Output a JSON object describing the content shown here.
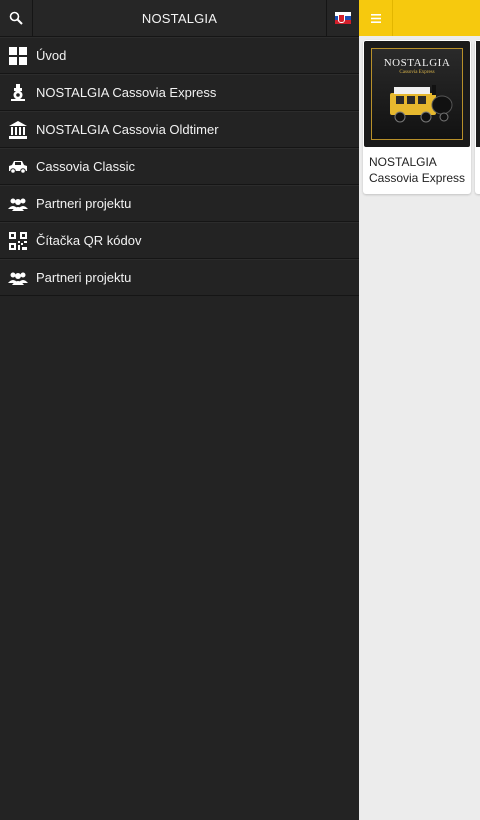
{
  "drawer": {
    "title": "NOSTALGIA",
    "items": [
      {
        "label": "Úvod",
        "icon": "grid-icon"
      },
      {
        "label": "NOSTALGIA Cassovia Express",
        "icon": "train-icon"
      },
      {
        "label": "NOSTALGIA Cassovia Oldtimer",
        "icon": "museum-icon"
      },
      {
        "label": "Cassovia Classic",
        "icon": "car-icon"
      },
      {
        "label": "Partneri projektu",
        "icon": "people-icon"
      },
      {
        "label": "Čítačka QR kódov",
        "icon": "qr-code-icon"
      },
      {
        "label": "Partneri projektu",
        "icon": "people-icon"
      }
    ]
  },
  "content": {
    "cards": [
      {
        "label": "NOSTALGIA Cassovia Express",
        "thumb_title": "NOSTALGIA",
        "thumb_subtitle": "Cassovia Express"
      }
    ]
  },
  "colors": {
    "drawer_bg": "#232323",
    "accent_yellow": "#f6c90e",
    "content_bg": "#ececec"
  }
}
